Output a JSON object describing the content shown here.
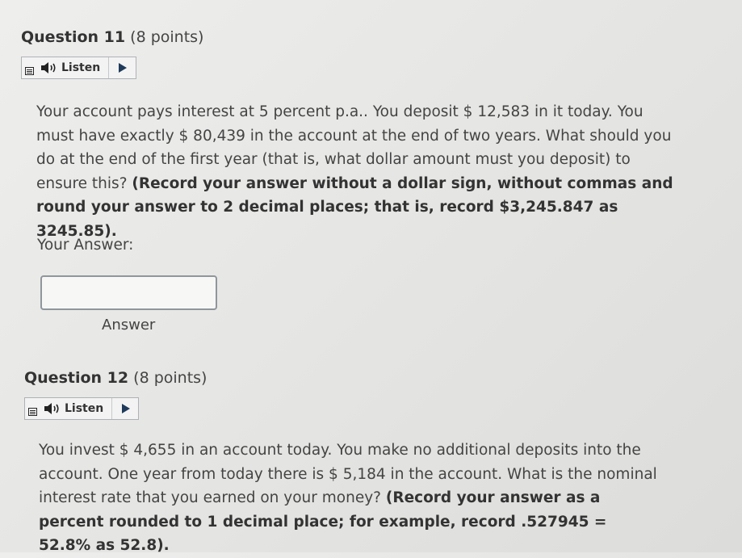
{
  "q11": {
    "heading_number": "Question 11",
    "heading_points": "(8 points)",
    "listen_label": "Listen",
    "text_plain": "Your account pays interest at 5 percent p.a.. You deposit $ 12,583 in it today. You must have exactly $ 80,439 in the account at the end of two years. What should you do at the end of the first year (that is, what dollar amount must you deposit) to ensure this? ",
    "text_bold": "(Record your answer without a dollar sign, without commas and round your answer to 2 decimal places; that is, record $3,245.847 as 3245.85).",
    "your_answer_label": "Your Answer:",
    "answer_value": "",
    "answer_caption": "Answer"
  },
  "q12": {
    "heading_number": "Question 12",
    "heading_points": "(8 points)",
    "listen_label": "Listen",
    "text_plain": "You invest $ 4,655 in an account today. You make no additional deposits into the account. One year from today there is $ 5,184 in the account. What is the nominal interest rate that you earned on your money? ",
    "text_bold": "(Record your answer as a percent rounded to 1 decimal place; for example, record .527945 = 52.8% as 52.8)."
  },
  "icons": {
    "menu": "menu-icon",
    "speaker": "speaker-icon",
    "play": "play-icon"
  },
  "colors": {
    "background": "#e6e6e4",
    "play_triangle": "#1f3a5a",
    "input_border": "#8f969c"
  }
}
